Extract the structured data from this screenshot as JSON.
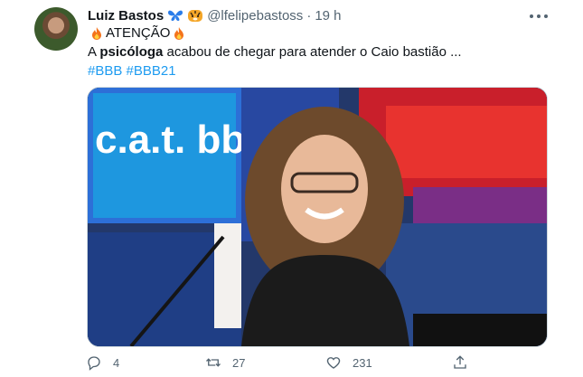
{
  "tweet": {
    "author_name": "Luiz Bastos",
    "author_handle": "@lfelipebastoss",
    "separator": "·",
    "time": "19 h",
    "line1_text": "ATENÇÃO",
    "line2_bold": "psicóloga",
    "line2_prefix": "A ",
    "line2_suffix": " acabou de chegar para atender o Caio bastião ...",
    "hashtags": [
      "#BBB",
      "#BBB21"
    ],
    "media_text": "c.a.t. bbb"
  },
  "actions": {
    "reply_count": "4",
    "retweet_count": "27",
    "like_count": "231"
  },
  "colors": {
    "accent": "#1d9bf0",
    "text_secondary": "#536471"
  }
}
